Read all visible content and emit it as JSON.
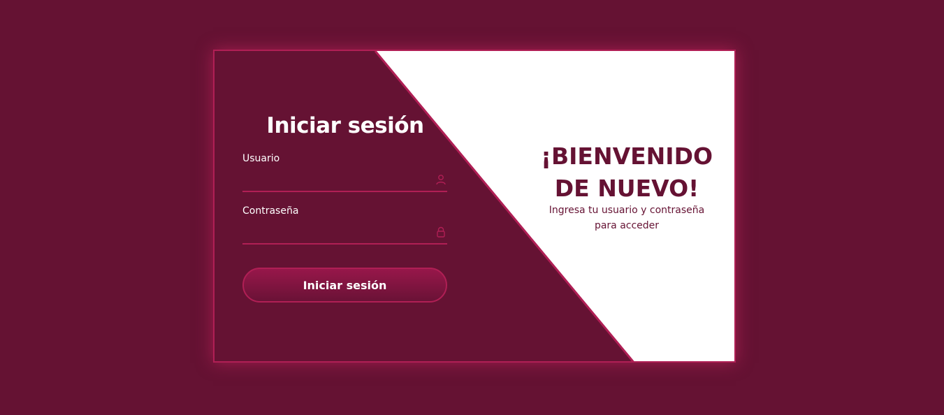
{
  "login": {
    "title": "Iniciar sesión",
    "username_label": "Usuario",
    "username_value": "",
    "password_label": "Contraseña",
    "password_value": "",
    "submit_label": "Iniciar sesión"
  },
  "welcome": {
    "title": "¡BIENVENIDO DE NUEVO!",
    "subtitle": "Ingresa tu usuario y contraseña para acceder"
  },
  "icons": {
    "username": "user-icon",
    "password": "lock-icon"
  },
  "colors": {
    "background": "#651233",
    "accent": "#b01f55",
    "panel": "#ffffff",
    "button_top": "#97174a",
    "button_bottom": "#6a1236"
  }
}
